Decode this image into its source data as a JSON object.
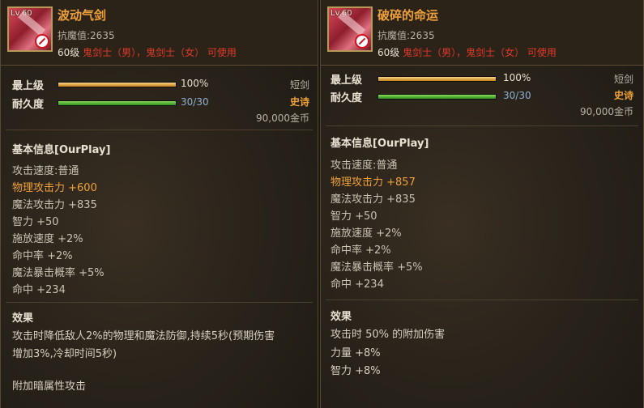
{
  "left": {
    "icon_level": "Lv.60",
    "name": "波动气剑",
    "anti_magic": "抗魔值:2635",
    "req_level": "60级",
    "req_class": "鬼剑士（男），鬼剑士（女） 可使用",
    "max_label": "最上级",
    "max_value": "100%",
    "max_fraction": 1.0,
    "dur_label": "耐久度",
    "dur_value": "30/30",
    "dur_fraction": 1.0,
    "item_type": "短剑",
    "grade": "史诗",
    "price": "90,000金币",
    "basic_header": "基本信息[OurPlay]",
    "stats": [
      {
        "text": "攻击速度:普通",
        "highlight": false
      },
      {
        "text": "物理攻击力 +600",
        "highlight": true
      },
      {
        "text": "魔法攻击力 +835",
        "highlight": false
      },
      {
        "text": "智力 +50",
        "highlight": false
      },
      {
        "text": "施放速度 +2%",
        "highlight": false
      },
      {
        "text": "命中率 +2%",
        "highlight": false
      },
      {
        "text": "魔法暴击概率 +5%",
        "highlight": false
      },
      {
        "text": "命中 +234",
        "highlight": false
      }
    ],
    "effect_header": "效果",
    "effect_line1": "攻击时降低敌人2%的物理和魔法防御,持续5秒(预期伤害",
    "effect_line2": "增加3%,冷却时间5秒)",
    "effect_line3": "附加暗属性攻击"
  },
  "right": {
    "icon_level": "Lv.60",
    "name": "破碎的命运",
    "anti_magic": "抗魔值:2635",
    "req_level": "60级",
    "req_class": "鬼剑士（男），鬼剑士（女） 可使用",
    "max_label": "最上级",
    "max_value": "100%",
    "max_fraction": 1.0,
    "dur_label": "耐久度",
    "dur_value": "30/30",
    "dur_fraction": 1.0,
    "item_type": "短剑",
    "grade": "史诗",
    "price": "90,000金币",
    "basic_header": "基本信息[OurPlay]",
    "stats": [
      {
        "text": "攻击速度:普通",
        "highlight": false
      },
      {
        "text": "物理攻击力 +857",
        "highlight": true
      },
      {
        "text": "魔法攻击力 +835",
        "highlight": false
      },
      {
        "text": "智力 +50",
        "highlight": false
      },
      {
        "text": "施放速度 +2%",
        "highlight": false
      },
      {
        "text": "命中率 +2%",
        "highlight": false
      },
      {
        "text": "魔法暴击概率 +5%",
        "highlight": false
      },
      {
        "text": "命中 +234",
        "highlight": false
      }
    ],
    "effect_header": "效果",
    "effect_line1": "攻击时 50% 的附加伤害",
    "effect_line2": "力量 +8%",
    "effect_line3": "智力 +8%"
  }
}
